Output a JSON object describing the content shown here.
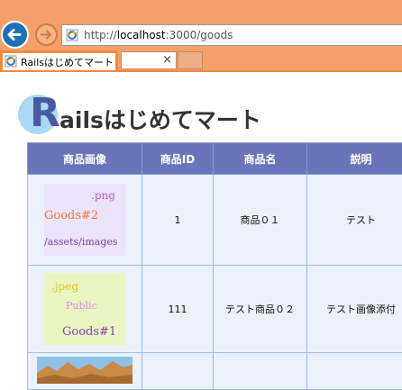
{
  "browser": {
    "url_prefix": "http://",
    "url_host": "localhost",
    "url_rest": ":3000/goods",
    "tab_title": "Railsはじめてマート",
    "tab_close": "×",
    "colors": {
      "chrome": "#f4a06a",
      "accent": "#f08a3c",
      "back_button": "#1f6fb5"
    },
    "icons": {
      "back": "back-arrow-icon",
      "forward": "forward-arrow-icon",
      "page": "ie-page-icon"
    }
  },
  "page": {
    "logo_letter": "R",
    "logo_text": "ailsはじめてマート",
    "table": {
      "headers": [
        "商品画像",
        "商品ID",
        "商品名",
        "説明"
      ],
      "rows": [
        {
          "image_lines": [
            ".png",
            "Goods#2",
            "/assets/images"
          ],
          "id": "1",
          "name": "商品０１",
          "description": "テスト"
        },
        {
          "image_lines": [
            ".jpeg",
            "Public",
            "Goods#1"
          ],
          "id": "111",
          "name": "テスト商品０２",
          "description": "テスト画像添付"
        },
        {
          "image_lines": [],
          "id": "",
          "name": "",
          "description": ""
        }
      ],
      "colors": {
        "header_bg": "#6b74b8",
        "cell_bg": "#eaf1fb",
        "border": "#9fc1e0"
      }
    }
  }
}
